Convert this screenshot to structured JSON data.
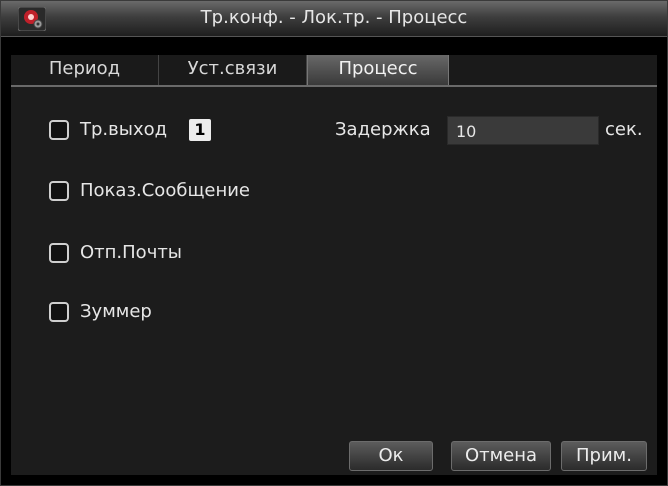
{
  "window": {
    "title": "Тр.конф. - Лок.тр. - Процесс",
    "icon": "dvr-camera-gear-icon"
  },
  "tabs": [
    {
      "label": "Период",
      "active": false
    },
    {
      "label": "Уст.связи",
      "active": false
    },
    {
      "label": "Процесс",
      "active": true
    }
  ],
  "options": {
    "alarm_output": {
      "label": "Тр.выход",
      "checked": false,
      "channel": "1"
    },
    "show_message": {
      "label": "Показ.Сообщение",
      "checked": false
    },
    "send_email": {
      "label": "Отп.Почты",
      "checked": false
    },
    "buzzer": {
      "label": "Зуммер",
      "checked": false
    }
  },
  "delay": {
    "label": "Задержка",
    "value": "10",
    "unit": "сек."
  },
  "buttons": {
    "ok": "Ок",
    "cancel": "Отмена",
    "apply": "Прим."
  },
  "colors": {
    "icon_red": "#c0202a",
    "active_tab": "#5a5a5a",
    "panel_bg": "#1c1c1c"
  }
}
